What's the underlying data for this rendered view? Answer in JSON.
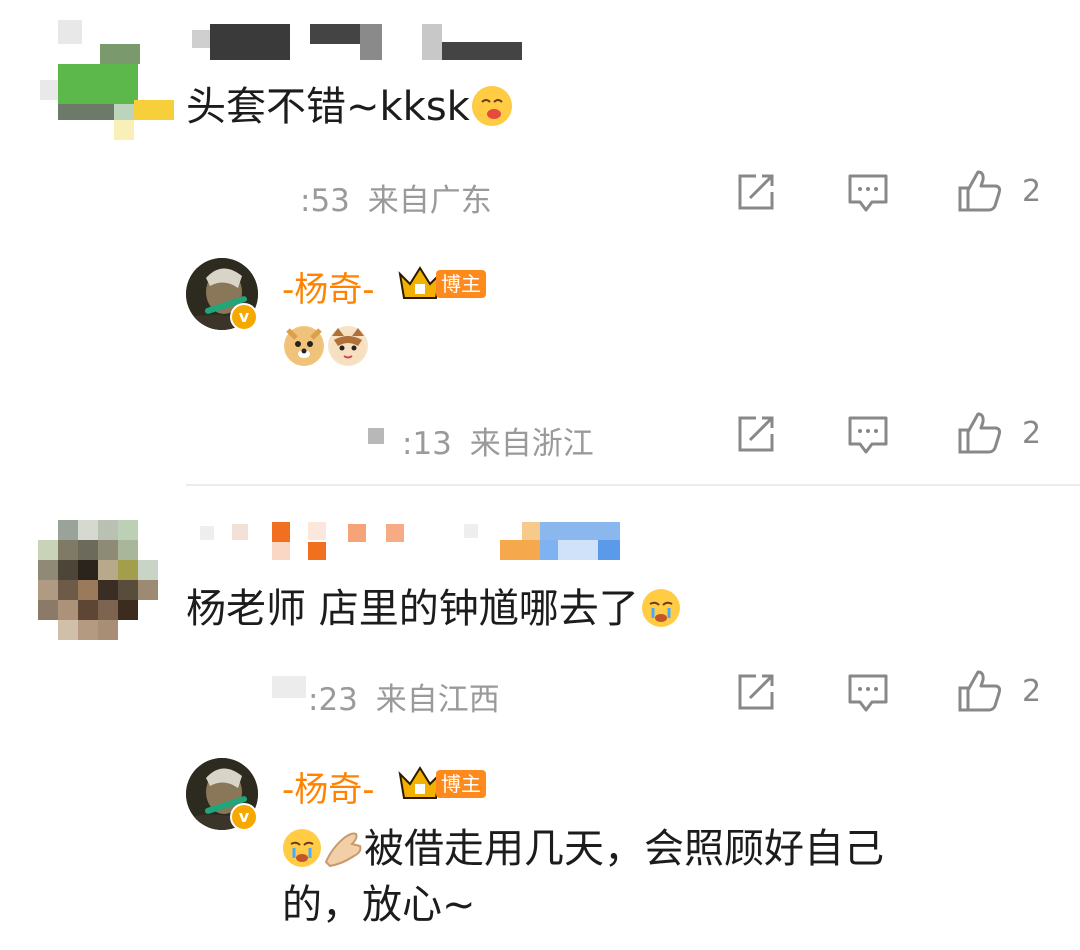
{
  "comments": [
    {
      "text": "头套不错~kksk",
      "time": ":53",
      "location": "来自广东",
      "likes": "2",
      "reply": {
        "author": "-杨奇-",
        "badge": "博主",
        "time": ":13",
        "location": "来自浙江",
        "likes": "2"
      }
    },
    {
      "text": "杨老师 店里的钟馗哪去了",
      "time": ":23",
      "location": "来自江西",
      "likes": "2",
      "reply": {
        "author": "-杨奇-",
        "badge": "博主",
        "text_line1": "被借走用几天，会照顾好自己",
        "text_line2": "的，放心~"
      }
    }
  ],
  "icons": {
    "share": "share-icon",
    "comment": "comment-icon",
    "like": "thumbs-up-icon"
  },
  "colors": {
    "name": "#ff8200",
    "meta": "#9a9a9a",
    "badge": "#ff8a1c",
    "verified": "#f7a800"
  }
}
